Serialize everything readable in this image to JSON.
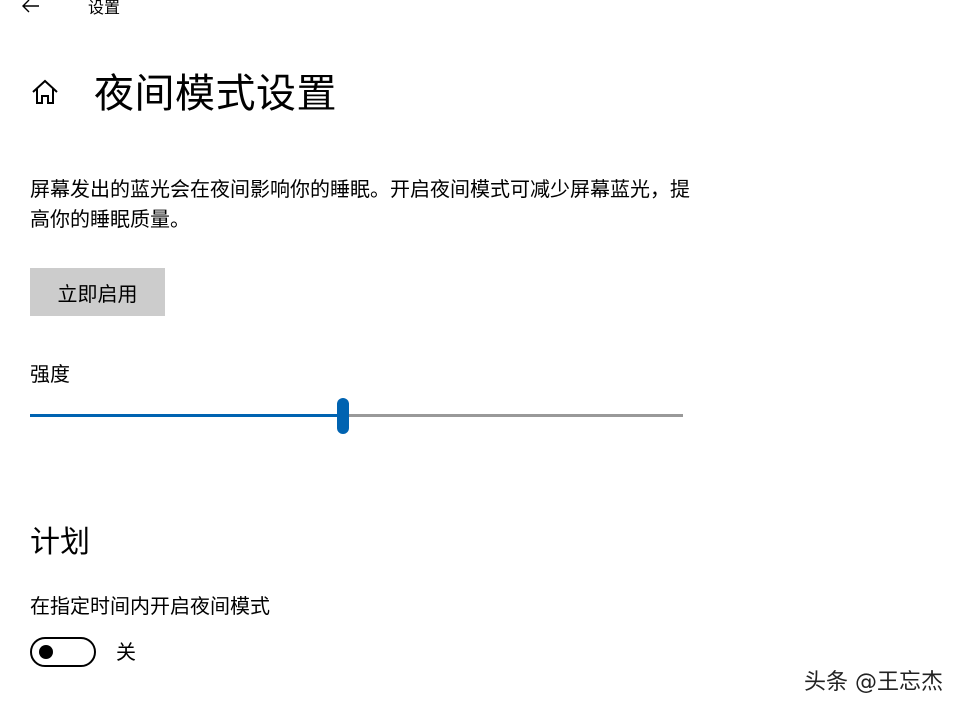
{
  "titlebar": {
    "back_icon": "arrow-left-icon",
    "app_title": "设置"
  },
  "header": {
    "home_icon": "home-icon",
    "title": "夜间模式设置"
  },
  "main": {
    "description": "屏幕发出的蓝光会在夜间影响你的睡眠。开启夜间模式可减少屏幕蓝光，提高你的睡眠质量。",
    "enable_button_label": "立即启用",
    "strength": {
      "label": "强度",
      "value_percent": 48,
      "accent_color": "#0063b1"
    }
  },
  "schedule": {
    "title": "计划",
    "label": "在指定时间内开启夜间模式",
    "toggle_on": false,
    "toggle_state_label": "关"
  },
  "watermark": "头条 @王忘杰"
}
